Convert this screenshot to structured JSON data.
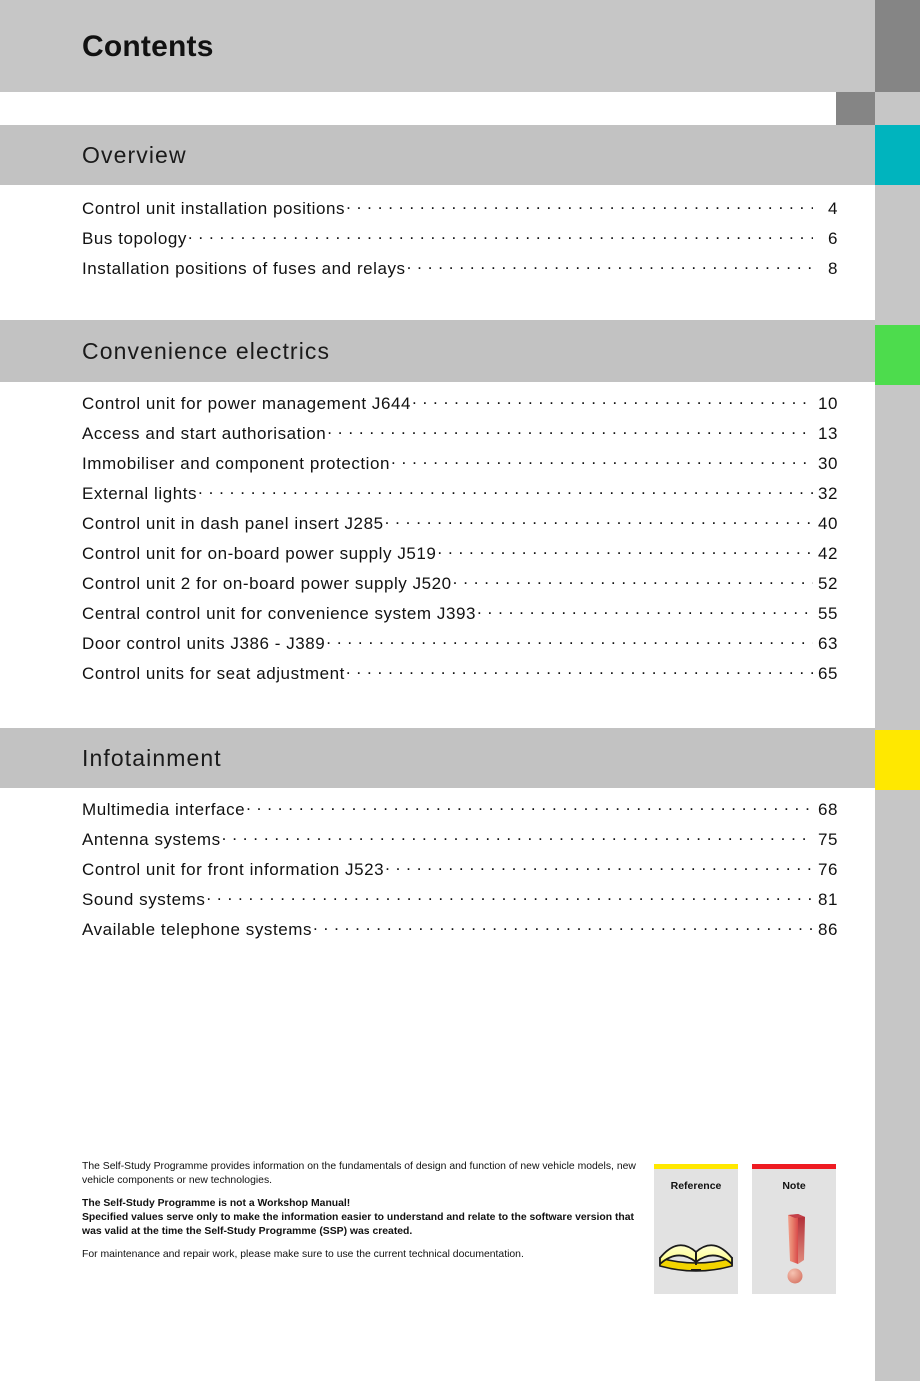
{
  "page": {
    "title": "Contents"
  },
  "colors": {
    "band_gray": "#c2c2c2",
    "rail_gray": "#c6c6c6",
    "rail_dark": "#858585",
    "tab_overview": "#00b4be",
    "tab_convenience": "#4ddc4d",
    "tab_infotainment": "#ffe800",
    "note_red": "#ee1b22",
    "reference_yellow": "#ffe800"
  },
  "sections": [
    {
      "id": "overview",
      "title": "Overview",
      "tab_color": "#00b4be",
      "entries": [
        {
          "label": "Control unit installation positions",
          "page": "4"
        },
        {
          "label": "Bus topology",
          "page": "6"
        },
        {
          "label": "Installation positions of fuses and relays",
          "page": "8"
        }
      ]
    },
    {
      "id": "convenience",
      "title": "Convenience electrics",
      "tab_color": "#4ddc4d",
      "entries": [
        {
          "label": "Control unit for power management J644",
          "page": "10"
        },
        {
          "label": "Access and start authorisation",
          "page": "13"
        },
        {
          "label": "Immobiliser and component protection",
          "page": "30"
        },
        {
          "label": "External lights",
          "page": "32"
        },
        {
          "label": "Control unit in dash panel insert J285",
          "page": "40"
        },
        {
          "label": "Control unit for on-board power supply J519",
          "page": "42"
        },
        {
          "label": "Control unit 2 for on-board power supply J520",
          "page": "52"
        },
        {
          "label": "Central control unit for convenience system J393",
          "page": "55"
        },
        {
          "label": "Door control units J386 - J389",
          "page": "63"
        },
        {
          "label": "Control units for seat adjustment",
          "page": "65"
        }
      ]
    },
    {
      "id": "infotainment",
      "title": "Infotainment",
      "tab_color": "#ffe800",
      "entries": [
        {
          "label": "Multimedia interface",
          "page": "68"
        },
        {
          "label": "Antenna systems",
          "page": "75"
        },
        {
          "label": "Control unit for front information J523",
          "page": "76"
        },
        {
          "label": "Sound systems",
          "page": "81"
        },
        {
          "label": "Available telephone systems",
          "page": "86"
        }
      ]
    }
  ],
  "legend": {
    "intro": "The Self-Study Programme provides information on the fundamentals of design and function of new vehicle models, new vehicle components or new technologies.",
    "warning_line1": "The Self-Study Programme is not a Workshop Manual!",
    "warning_line2": "Specified values serve only to make the information easier to understand and relate to the software version that was valid at the time the Self-Study Programme (SSP) was created.",
    "closing": "For maintenance and repair work, please make sure to use the current technical documentation."
  },
  "icon_boxes": [
    {
      "id": "reference",
      "caption": "Reference",
      "bar_color": "#ffe800",
      "icon": "open-book-icon"
    },
    {
      "id": "note",
      "caption": "Note",
      "bar_color": "#ee1b22",
      "icon": "exclamation-mark-icon"
    }
  ]
}
